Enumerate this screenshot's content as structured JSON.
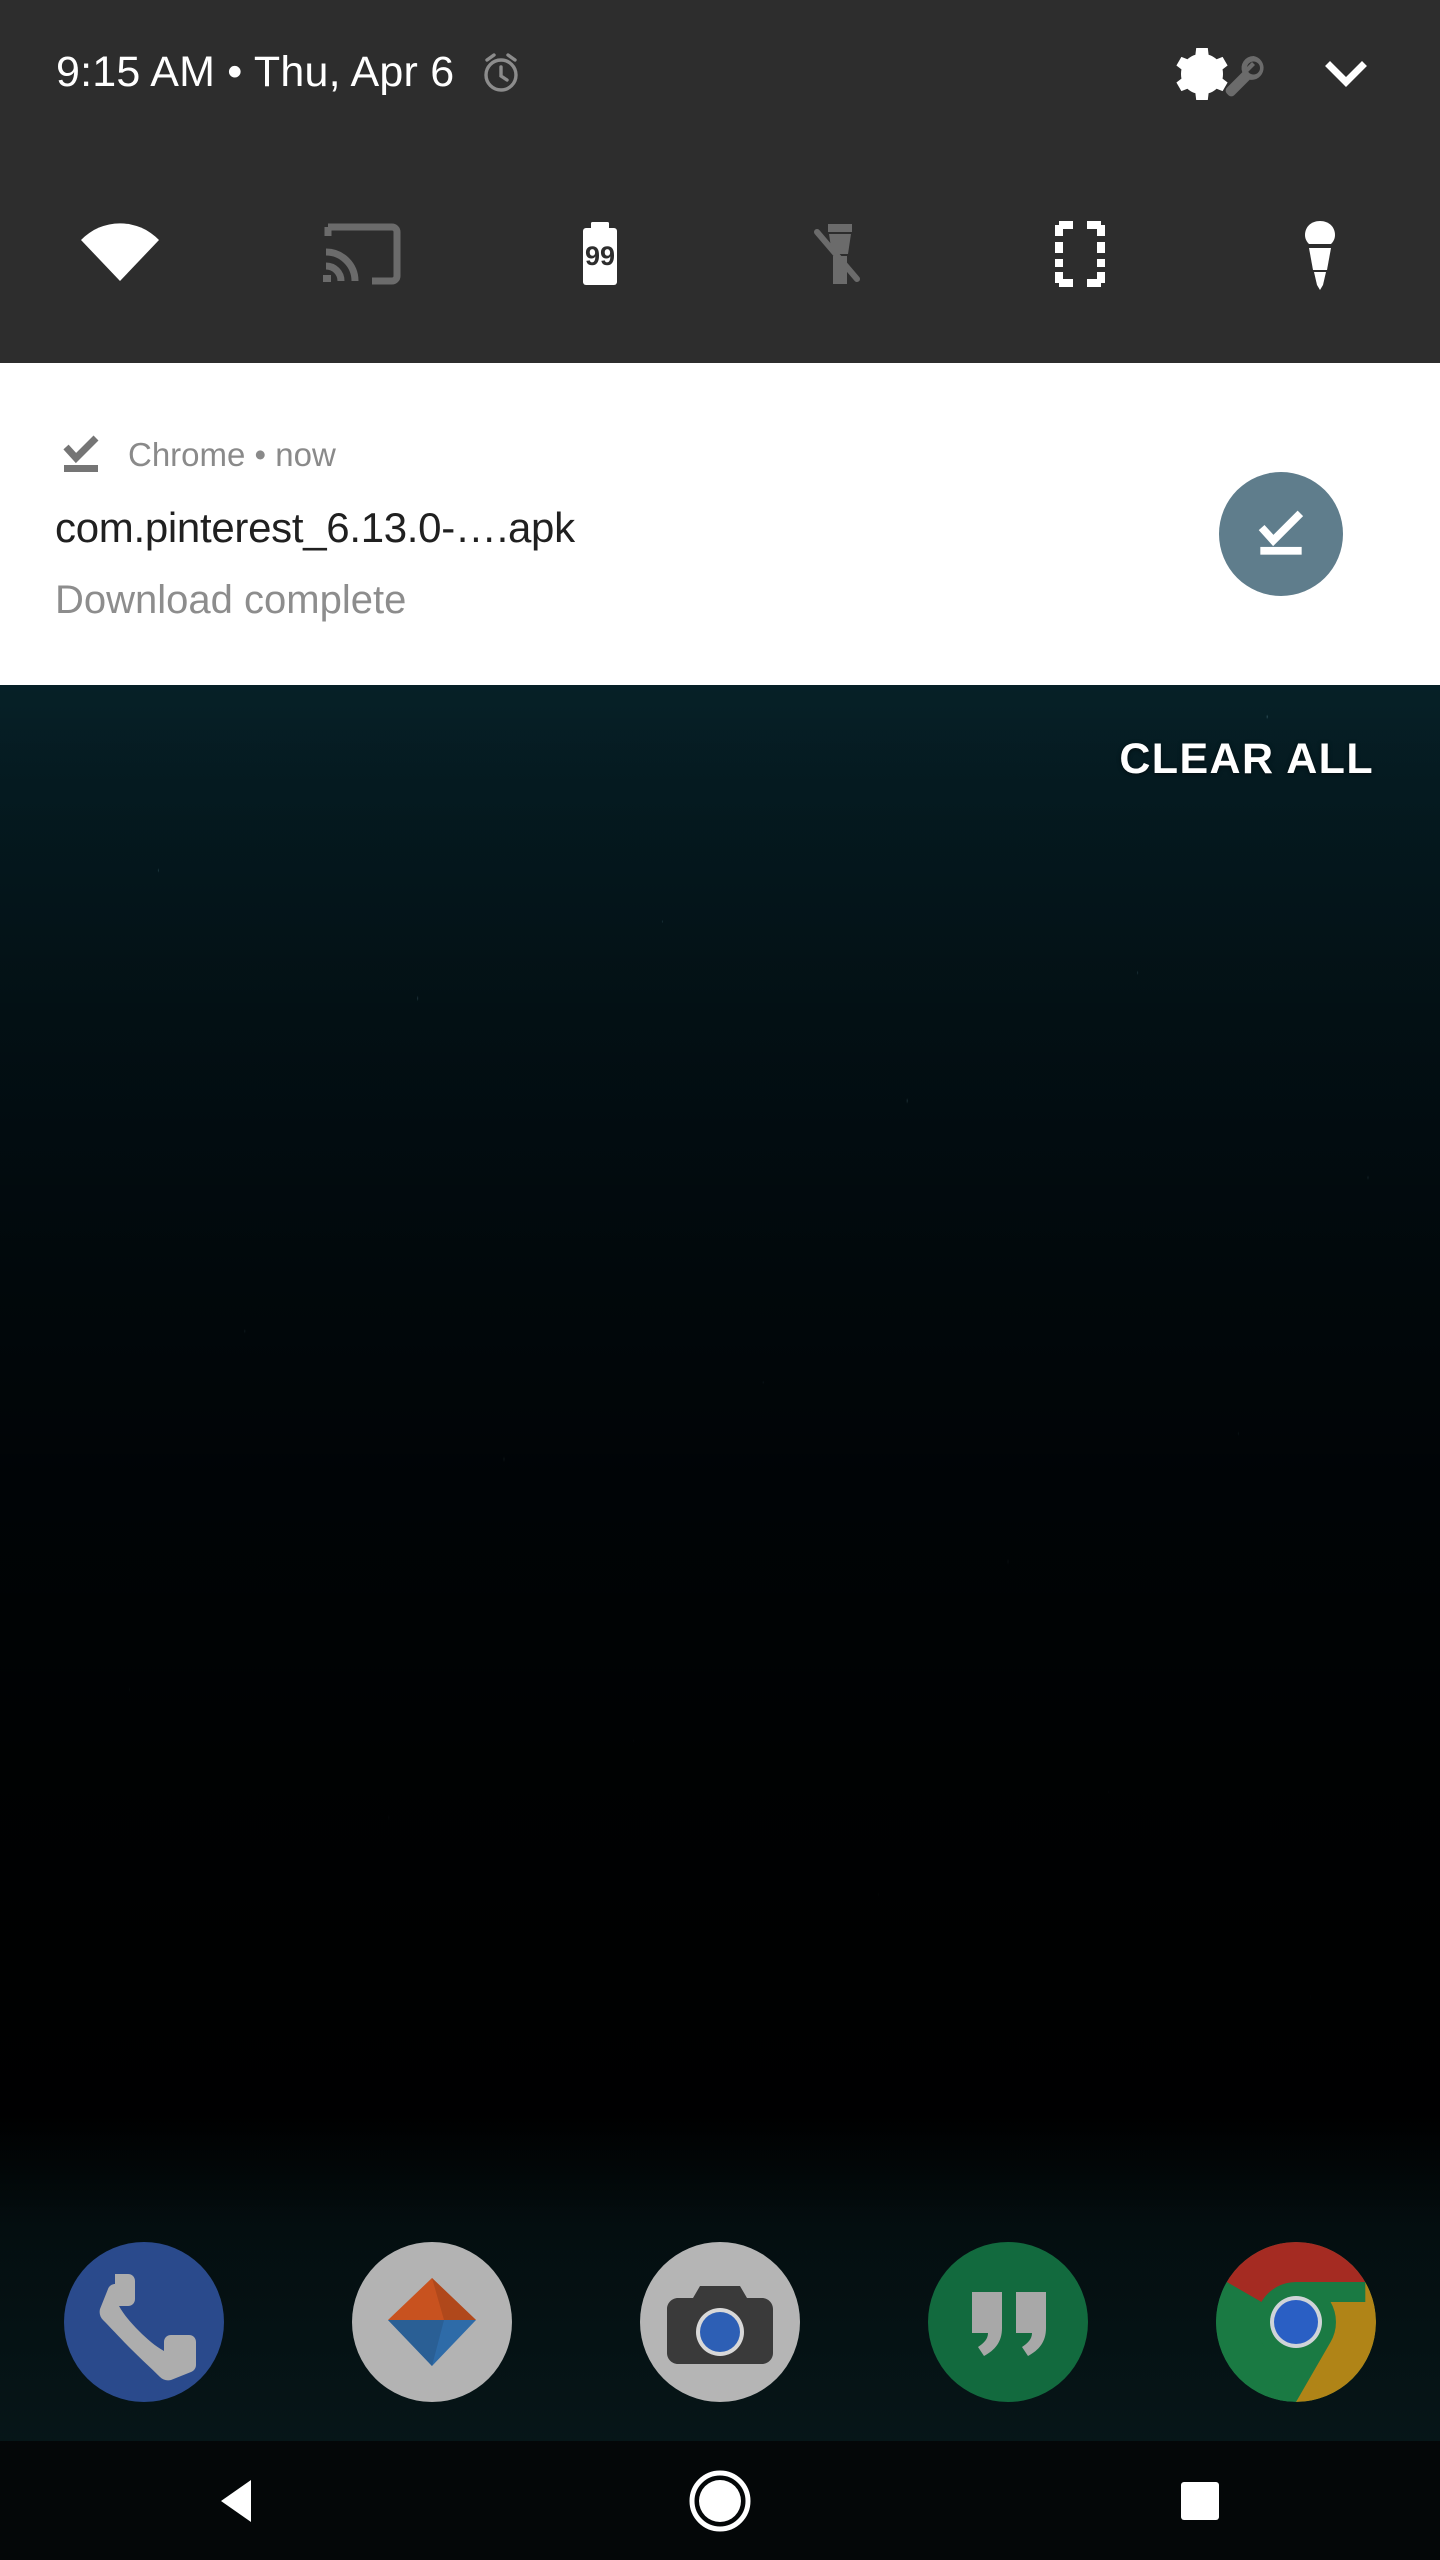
{
  "status_bar": {
    "clock": "9:15 AM  •  Thu, Apr 6",
    "alarm_icon": "alarm-clock-icon",
    "settings_icon": "gear-icon",
    "wrench_icon": "wrench-icon",
    "collapse_icon": "chevron-down-icon"
  },
  "quick_settings": {
    "tiles": [
      {
        "name": "wifi",
        "icon": "wifi-icon",
        "label": "Wi-Fi",
        "state": "on"
      },
      {
        "name": "cast",
        "icon": "cast-icon",
        "label": "Cast",
        "state": "off"
      },
      {
        "name": "battery",
        "icon": "battery-icon",
        "label": "Battery",
        "value": "99",
        "state": "on"
      },
      {
        "name": "flashlight-off",
        "icon": "flashlight-off-icon",
        "label": "Flashlight",
        "state": "off"
      },
      {
        "name": "auto-rotate",
        "icon": "screen-rotation-icon",
        "label": "Auto-rotate",
        "state": "on"
      },
      {
        "name": "flashlight-on",
        "icon": "flashlight-on-icon",
        "label": "Flashlight",
        "state": "on"
      }
    ]
  },
  "notification": {
    "app_name": "Chrome",
    "separator": "•",
    "time": "now",
    "header": "Chrome • now",
    "title": "com.pinterest_6.13.0-….apk",
    "subtitle": "Download complete",
    "small_icon": "download-done-icon",
    "action_icon": "download-done-icon",
    "action_color": "#5f7d8c"
  },
  "shade": {
    "clear_all_label": "CLEAR ALL",
    "panel_color": "#2d2d2d",
    "card_color": "#ffffff"
  },
  "dock": {
    "apps": [
      {
        "name": "phone",
        "label": "Phone",
        "icon": "phone-icon",
        "color": "#2a4a8c"
      },
      {
        "name": "messages",
        "label": "Messages",
        "icon": "triangles-icon",
        "color": "#b3b3b3"
      },
      {
        "name": "camera",
        "label": "Camera",
        "icon": "camera-icon",
        "color": "#b5b5b5"
      },
      {
        "name": "hangouts",
        "label": "Hangouts",
        "icon": "quotes-icon",
        "color": "#126a3e"
      },
      {
        "name": "chrome",
        "label": "Chrome",
        "icon": "chrome-icon",
        "color": "#4285f4"
      }
    ]
  },
  "nav_bar": {
    "buttons": [
      {
        "name": "back",
        "label": "Back",
        "icon": "triangle-back-icon"
      },
      {
        "name": "home",
        "label": "Home",
        "icon": "circle-home-icon"
      },
      {
        "name": "recents",
        "label": "Recents",
        "icon": "square-recents-icon"
      }
    ]
  }
}
